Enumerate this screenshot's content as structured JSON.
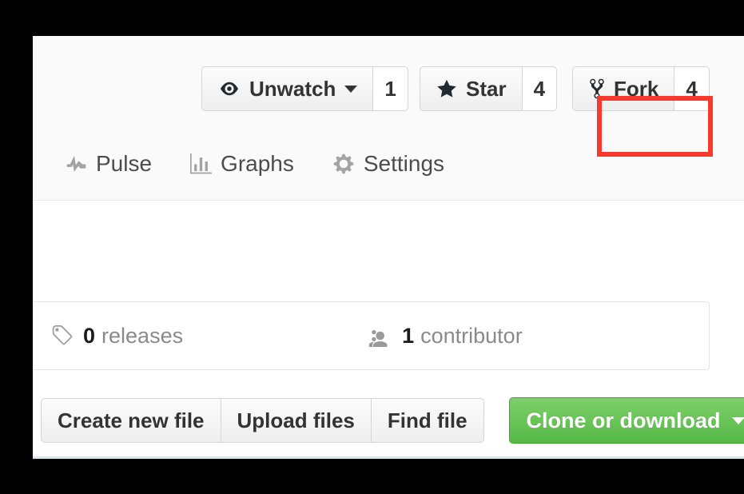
{
  "repo_actions": {
    "watch": {
      "icon": "eye-icon",
      "label": "Unwatch",
      "has_caret": true,
      "count": "1"
    },
    "star": {
      "icon": "star-icon",
      "label": "Star",
      "has_caret": false,
      "count": "4"
    },
    "fork": {
      "icon": "repo-forked-icon",
      "label": "Fork",
      "has_caret": false,
      "count": "4",
      "highlighted": true,
      "highlight_color": "#f83a2e"
    }
  },
  "nav": {
    "items": [
      {
        "icon": "pulse-icon",
        "label": "Pulse"
      },
      {
        "icon": "graph-icon",
        "label": "Graphs"
      },
      {
        "icon": "gear-icon",
        "label": "Settings"
      }
    ]
  },
  "overview": {
    "releases": {
      "icon": "tag-icon",
      "count": "0",
      "label": "releases"
    },
    "contributors": {
      "icon": "people-icon",
      "count": "1",
      "label": "contributor"
    }
  },
  "file_toolbar": {
    "create_new_file": "Create new file",
    "upload_files": "Upload files",
    "find_file": "Find file",
    "clone_or_download": "Clone or download",
    "clone_button_color": "#60b044"
  }
}
